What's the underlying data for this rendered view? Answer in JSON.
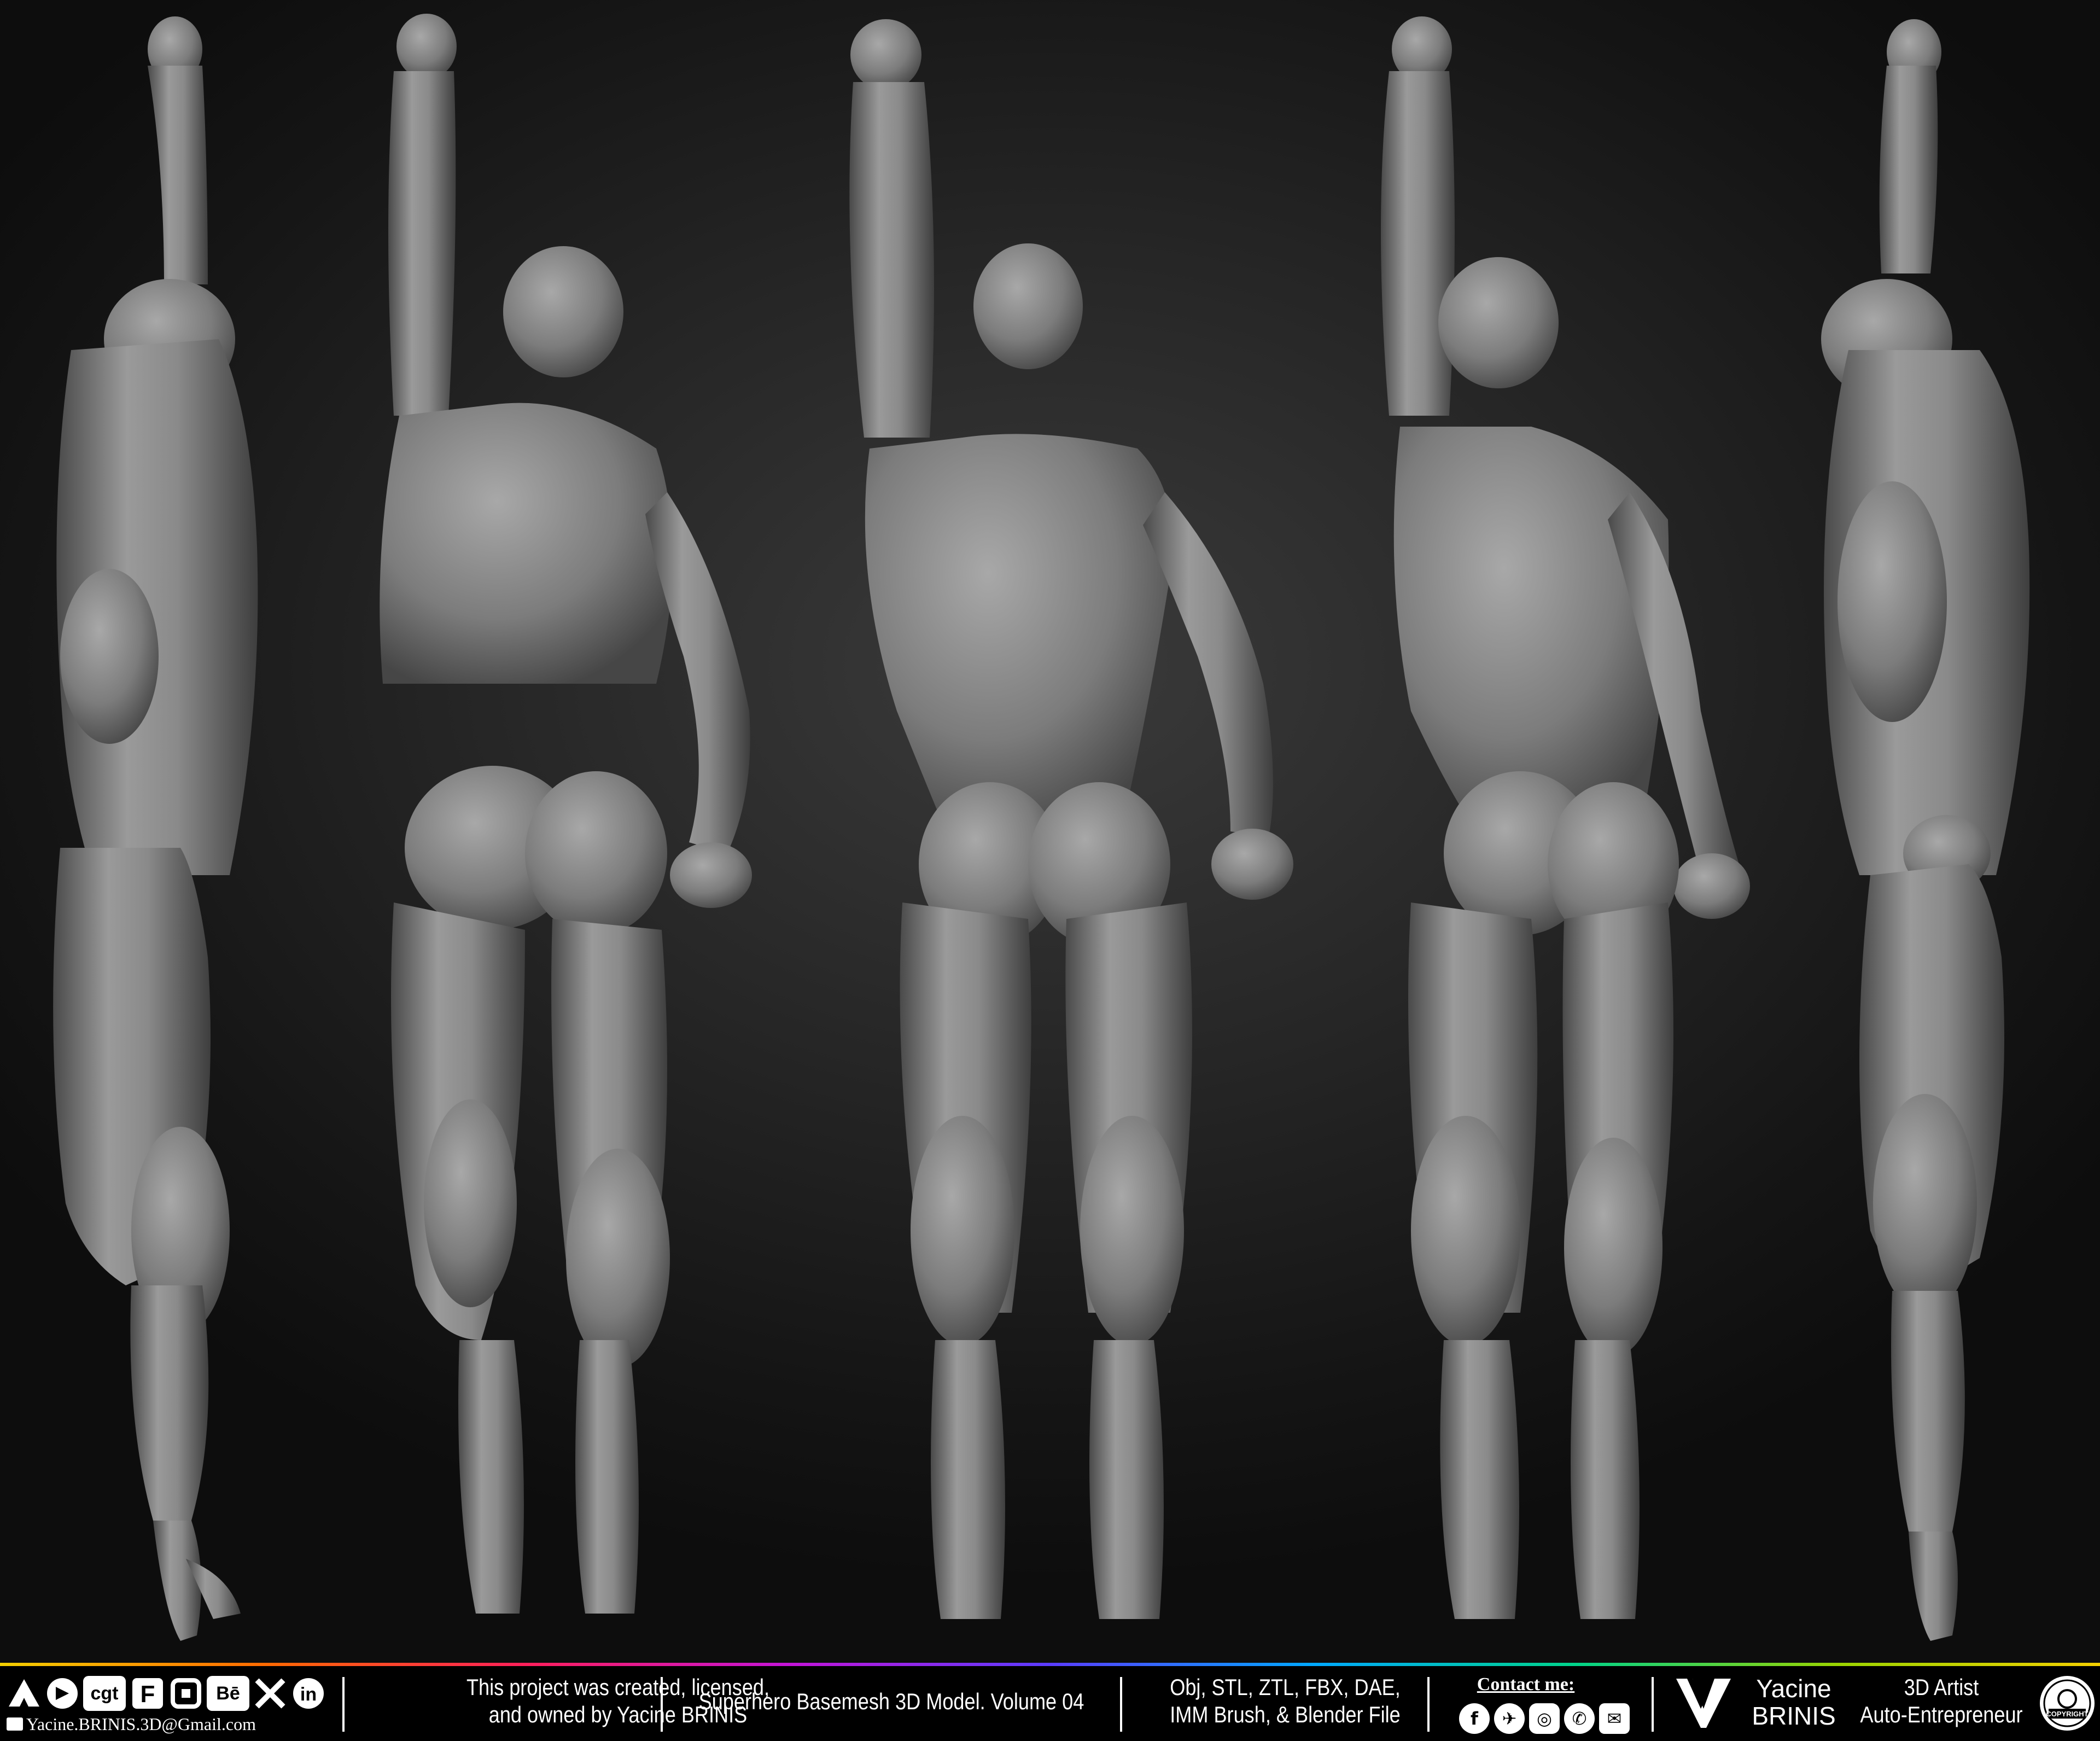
{
  "image": {
    "description_free": true,
    "background": "#1c1c1c",
    "figure_tone": "#8a8a8a"
  },
  "footer": {
    "social_icons": [
      "artstation-icon",
      "blender-market-icon",
      "cgtrader-icon",
      "fab-icon",
      "cube-icon",
      "behance-icon",
      "x-icon",
      "linkedin-icon"
    ],
    "cgt_label": "cgt",
    "behance_label": "Bē",
    "linkedin_label": "in",
    "email": "Yacine.BRINIS.3D@Gmail.com",
    "notice_line1": "This project was created, licensed,",
    "notice_line2": "and owned by Yacine BRINIS",
    "product_title": "Superhero Basemesh 3D Model. Volume 04",
    "formats_line1": "Obj, STL, ZTL, FBX, DAE,",
    "formats_line2": "IMM Brush, & Blender File",
    "contact_label": "Contact me:",
    "contact_icons": [
      "facebook-icon",
      "messenger-icon",
      "instagram-icon",
      "whatsapp-icon",
      "mail-icon"
    ],
    "brand_first": "Yacine",
    "brand_last": "BRINIS",
    "role_line1": "3D Artist",
    "role_line2": "Auto-Entrepreneur",
    "seal_text": "COPYRIGHT"
  }
}
